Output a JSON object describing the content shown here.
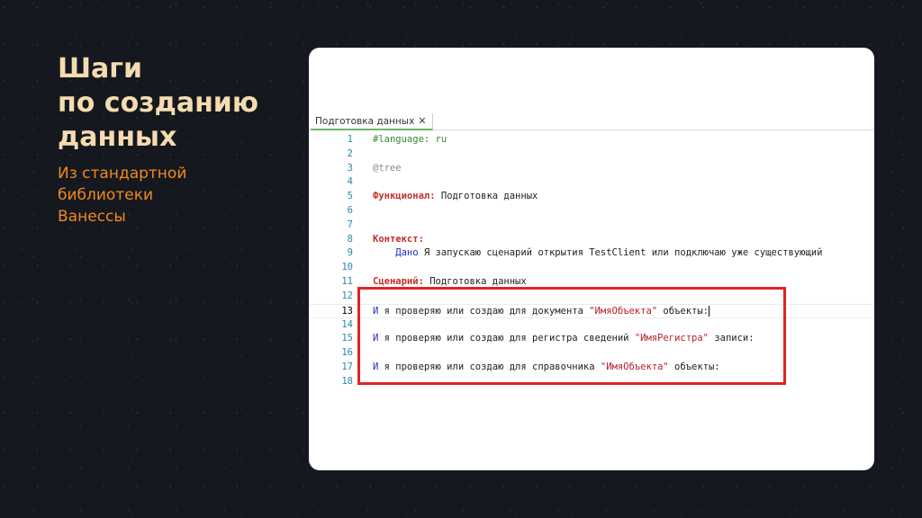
{
  "slide": {
    "title_lines": [
      "Шаги",
      "по созданию",
      "данных"
    ],
    "subtitle_lines": [
      "Из стандартной",
      "библиотеки",
      "Ванессы"
    ]
  },
  "editor": {
    "tab_label": "Подготовка данных",
    "tab_close": "✕",
    "lines": [
      {
        "n": "1",
        "parts": [
          {
            "t": "#language: ru",
            "c": "kw-green"
          }
        ]
      },
      {
        "n": "2",
        "parts": []
      },
      {
        "n": "3",
        "parts": [
          {
            "t": "@tree",
            "c": "kw-gray"
          }
        ]
      },
      {
        "n": "4",
        "parts": []
      },
      {
        "n": "5",
        "parts": [
          {
            "t": "Функционал:",
            "c": "kw-red"
          },
          {
            "t": " Подготовка данных",
            "c": ""
          }
        ]
      },
      {
        "n": "6",
        "parts": []
      },
      {
        "n": "7",
        "parts": []
      },
      {
        "n": "8",
        "parts": [
          {
            "t": "Контекст:",
            "c": "kw-red"
          }
        ]
      },
      {
        "n": "9",
        "parts": [
          {
            "t": "    Дано",
            "c": "kw-blue"
          },
          {
            "t": " Я запускаю сценарий открытия TestClient или подключаю уже существующий",
            "c": ""
          }
        ]
      },
      {
        "n": "10",
        "parts": []
      },
      {
        "n": "11",
        "parts": [
          {
            "t": "Сценарий:",
            "c": "kw-red"
          },
          {
            "t": " Подготовка данных",
            "c": ""
          }
        ]
      },
      {
        "n": "12",
        "parts": []
      },
      {
        "n": "13",
        "current": true,
        "parts": [
          {
            "t": "И",
            "c": "kw-blue"
          },
          {
            "t": " я проверяю или создаю для документа ",
            "c": ""
          },
          {
            "t": "\"ИмяОбъекта\"",
            "c": "str"
          },
          {
            "t": " объекты:",
            "c": ""
          }
        ]
      },
      {
        "n": "14",
        "parts": []
      },
      {
        "n": "15",
        "parts": [
          {
            "t": "И",
            "c": "kw-blue"
          },
          {
            "t": " я проверяю или создаю для регистра сведений ",
            "c": ""
          },
          {
            "t": "\"ИмяРегистра\"",
            "c": "str"
          },
          {
            "t": " записи:",
            "c": ""
          }
        ]
      },
      {
        "n": "16",
        "parts": []
      },
      {
        "n": "17",
        "parts": [
          {
            "t": "И",
            "c": "kw-blue"
          },
          {
            "t": " я проверяю или создаю для справочника ",
            "c": ""
          },
          {
            "t": "\"ИмяОбъекта\"",
            "c": "str"
          },
          {
            "t": " объекты:",
            "c": ""
          }
        ]
      },
      {
        "n": "18",
        "parts": []
      }
    ]
  },
  "colors": {
    "background": "#15181f",
    "title": "#f5dcb0",
    "subtitle": "#f08a1c",
    "highlight_border": "#e02424"
  }
}
